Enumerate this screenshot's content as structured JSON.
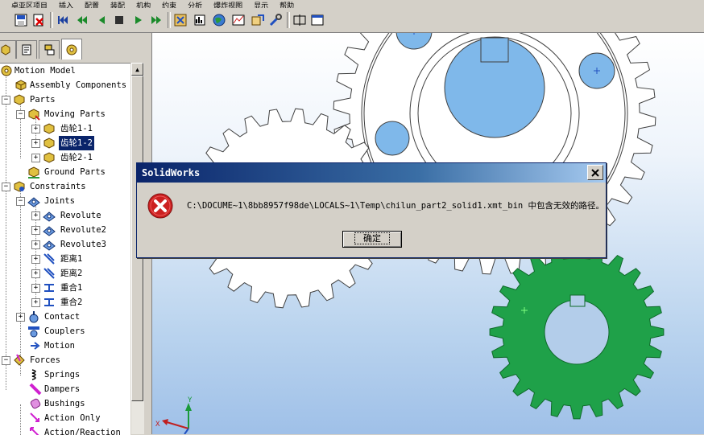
{
  "menubar": {
    "items": [
      "卓亚区项目",
      "插入",
      "配置",
      "装配",
      "机构",
      "约束",
      "分析",
      "爆炸视图",
      "显示",
      "帮助"
    ]
  },
  "toolbar": {
    "buttons": [
      "save-icon",
      "delete-icon",
      "first-frame-icon",
      "rewind-icon",
      "step-back-icon",
      "stop-icon",
      "play-icon",
      "fast-forward-icon",
      "simulate-icon",
      "results-icon",
      "globe-icon",
      "plot-icon",
      "export-icon",
      "tools-icon",
      "split-view-icon",
      "window-icon"
    ]
  },
  "panel": {
    "tabs": [
      "feature-manager-tab",
      "property-manager-tab",
      "configuration-manager-tab",
      "motion-manager-tab"
    ],
    "active_tab": 3
  },
  "tree": {
    "root": "Motion Model",
    "assembly_components": "Assembly Components",
    "parts": "Parts",
    "moving_parts": "Moving Parts",
    "gear1_1": "齿轮1-1",
    "gear1_2": "齿轮1-2",
    "gear2_1": "齿轮2-1",
    "ground_parts": "Ground Parts",
    "constraints": "Constraints",
    "joints": "Joints",
    "revolute": "Revolute",
    "revolute2": "Revolute2",
    "revolute3": "Revolute3",
    "distance1": "距离1",
    "distance2": "距离2",
    "coincident1": "重合1",
    "coincident2": "重合2",
    "contact": "Contact",
    "couplers": "Couplers",
    "motion": "Motion",
    "forces": "Forces",
    "springs": "Springs",
    "dampers": "Dampers",
    "bushings": "Bushings",
    "action_only": "Action Only",
    "action_reaction": "Action/Reaction"
  },
  "colors": {
    "selection": "#0a246a",
    "gear_green": "#1fa149",
    "dialog_title": "#0a246a",
    "error_red": "#cc2020"
  },
  "triad": {
    "x_label": "X",
    "y_label": "Y"
  },
  "dialog": {
    "title": "SolidWorks",
    "message": "C:\\DOCUME~1\\8bb8957f98de\\LOCALS~1\\Temp\\chilun_part2_solid1.xmt_bin 中包含无效的路径。",
    "ok_label": "确定",
    "icon": "error-icon"
  }
}
